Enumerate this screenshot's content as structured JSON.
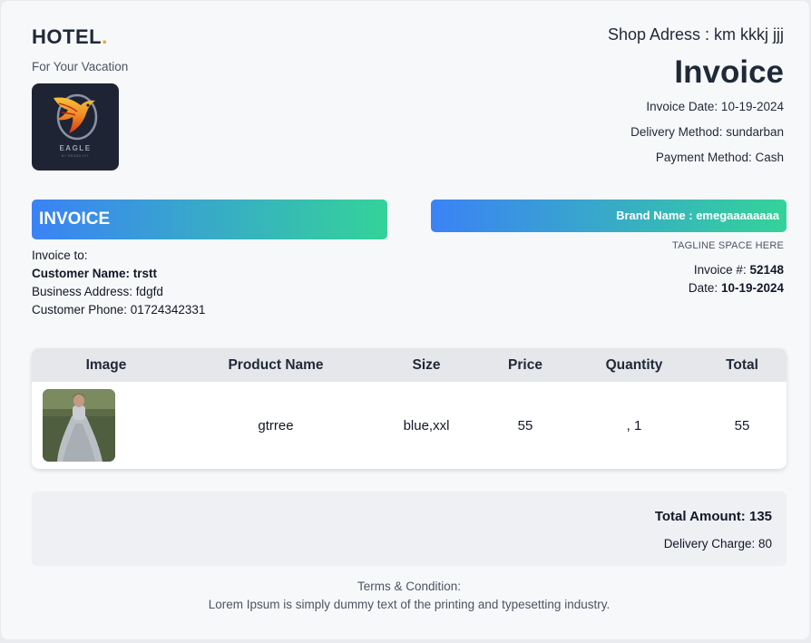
{
  "header": {
    "brand_name": "HOTEL",
    "brand_dot": ".",
    "tagline": "For Your Vacation",
    "logo_text": "EAGLE",
    "logo_subtext": "BY BRAND KIT",
    "shop_address": "Shop Adress : km kkkj jjj",
    "invoice_title": "Invoice",
    "invoice_date": "Invoice Date: 10-19-2024",
    "delivery_method": "Delivery Method: sundarban",
    "payment_method": "Payment Method: Cash"
  },
  "bars": {
    "left_label": "INVOICE",
    "right_label": "Brand Name : emegaaaaaaaa",
    "gradient_start": "#3b82f6",
    "gradient_end": "#34d399"
  },
  "bill_to": {
    "label": "Invoice to:",
    "customer_name": "Customer Name: trstt",
    "business_address": "Business Address: fdgfd",
    "customer_phone": "Customer Phone: 01724342331"
  },
  "invoice_info": {
    "tagline_space": "TAGLINE SPACE HERE",
    "invoice_number_label": "Invoice #: ",
    "invoice_number": "52148",
    "date_label": "Date: ",
    "date": "10-19-2024"
  },
  "table": {
    "headers": [
      "Image",
      "Product Name",
      "Size",
      "Price",
      "Quantity",
      "Total"
    ],
    "rows": [
      {
        "image": "product-photo-dress",
        "product_name": "gtrree",
        "size": "blue,xxl",
        "price": "55",
        "quantity": ", 1",
        "total": "55"
      }
    ]
  },
  "summary": {
    "total_amount": "Total Amount: 135",
    "delivery_charge": "Delivery Charge: 80"
  },
  "footer": {
    "terms_title": "Terms & Condition:",
    "terms_body": "Lorem Ipsum is simply dummy text of the printing and typesetting industry."
  },
  "colors": {
    "accent": "#f59e0b",
    "page_background": "#f7f8fa",
    "table_header_background": "#e5e7eb"
  }
}
